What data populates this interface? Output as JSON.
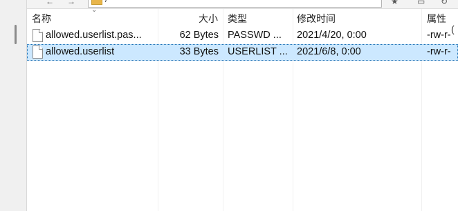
{
  "path_bar": {
    "value": "/"
  },
  "columns": {
    "name": "名称",
    "size": "大小",
    "type": "类型",
    "modified": "修改时间",
    "attributes": "属性"
  },
  "files": [
    {
      "name": "allowed.userlist.pas...",
      "size": "62 Bytes",
      "type": "PASSWD ...",
      "modified": "2021/4/20, 0:00",
      "attributes": "-rw-r-",
      "selected": false
    },
    {
      "name": "allowed.userlist",
      "size": "33 Bytes",
      "type": "USERLIST ...",
      "modified": "2021/6/8, 0:00",
      "attributes": "-rw-r-",
      "selected": true
    }
  ],
  "colors": {
    "selection_bg": "#cce8ff",
    "selection_border": "#1b6fb3"
  },
  "icons": {
    "sort": "chevron-down-icon",
    "file": "file-icon",
    "folder": "folder-icon"
  }
}
